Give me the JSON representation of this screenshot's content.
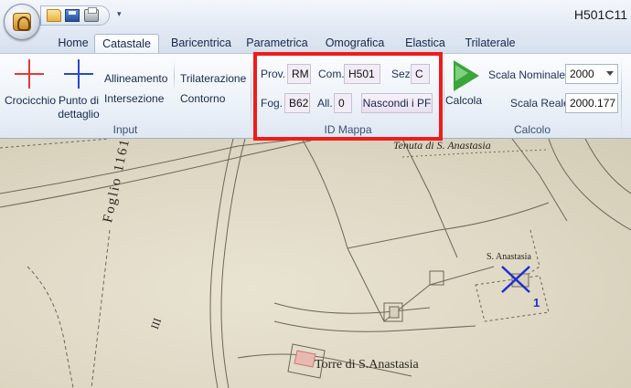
{
  "app": {
    "window_title": "H501C11",
    "quick_access": {
      "dropdown_glyph": "▾"
    }
  },
  "tabs": [
    "Home",
    "Catastale",
    "Baricentrica",
    "Parametrica",
    "Omografica",
    "Elastica",
    "Trilaterale"
  ],
  "active_tab": "Catastale",
  "ribbon": {
    "input": {
      "label": "Input",
      "crocicchio": "Crocicchio",
      "punto_line1": "Punto di",
      "punto_line2": "dettaglio",
      "allineamento": "Allineamento",
      "intersezione": "Intersezione",
      "trilaterazione": "Trilaterazione",
      "contorno": "Contorno"
    },
    "id_mappa": {
      "label": "ID Mappa",
      "prov_label": "Prov.",
      "prov_value": "RM",
      "com_label": "Com.",
      "com_value": "H501",
      "sez_label": "Sez.",
      "sez_value": "C",
      "fog_label": "Fog.",
      "fog_value": "B62",
      "all_label": "All.",
      "all_value": "0",
      "nascondi_button": "Nascondi i PF"
    },
    "calcolo": {
      "label": "Calcolo",
      "calcola": "Calcola",
      "scala_nominale_label": "Scala Nominale",
      "scala_nominale_value": "2000",
      "scala_reale_label": "Scala Reale",
      "scala_reale_value": "2000.177"
    }
  },
  "map": {
    "texts": {
      "foglio": "Foglio 1161",
      "tenuta": "Tenuta di S. Anastasia",
      "s_anastasia": "S. Anastasia",
      "torre": "Torre di S.Anastasia",
      "point_label": "1",
      "roman": "III"
    },
    "colors": {
      "marker": "#1d2fd0",
      "highlight": "#ee1c1c"
    }
  }
}
